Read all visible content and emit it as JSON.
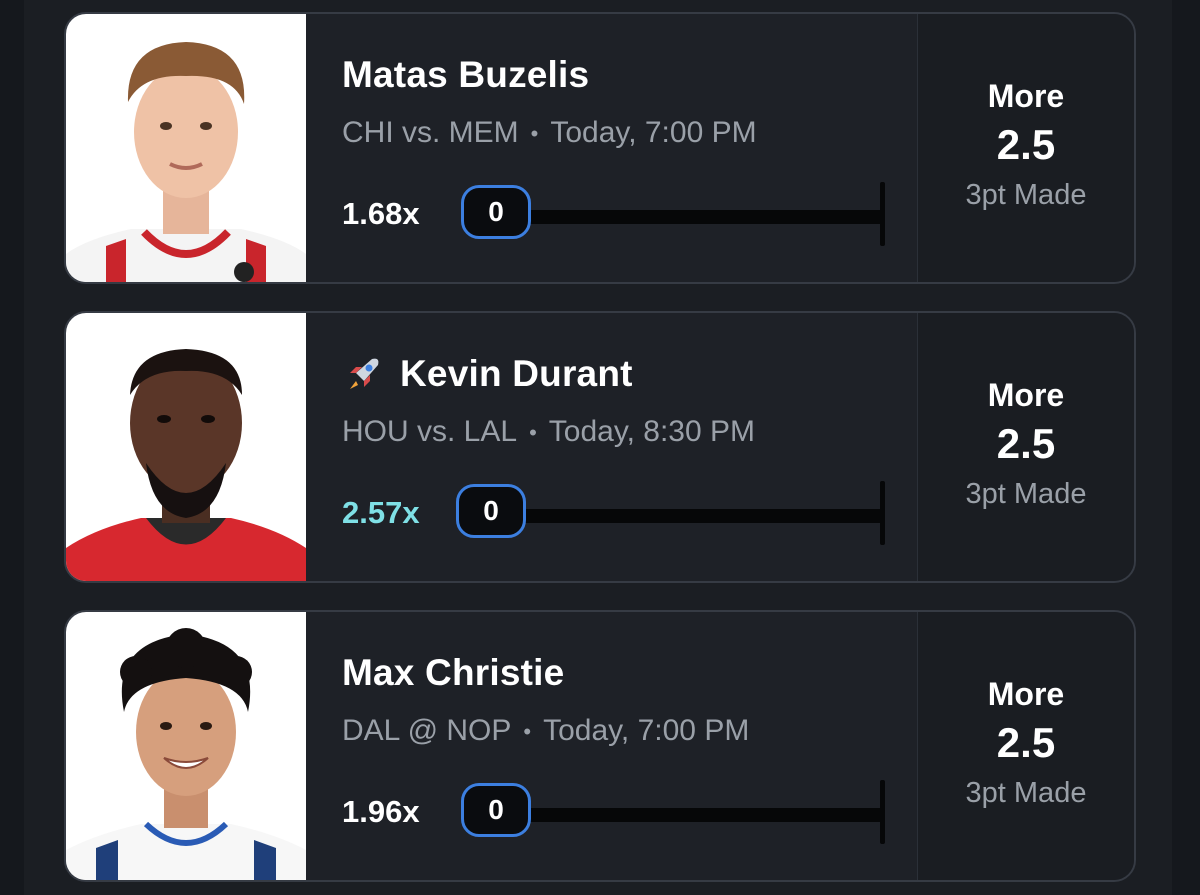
{
  "props": [
    {
      "player": "Matas Buzelis",
      "matchup": "CHI vs. MEM",
      "separator": "•",
      "time": "Today, 7:00 PM",
      "multiplier": "1.68x",
      "multiplier_color": "#ffffff",
      "stepper_value": "0",
      "direction": "More",
      "line": "2.5",
      "stat": "3pt Made",
      "badge_icon": ""
    },
    {
      "player": "Kevin Durant",
      "matchup": "HOU vs. LAL",
      "separator": "•",
      "time": "Today, 8:30 PM",
      "multiplier": "2.57x",
      "multiplier_color": "#7fe0e6",
      "stepper_value": "0",
      "direction": "More",
      "line": "2.5",
      "stat": "3pt Made",
      "badge_icon": "rocket-icon"
    },
    {
      "player": "Max Christie",
      "matchup": "DAL @ NOP",
      "separator": "•",
      "time": "Today, 7:00 PM",
      "multiplier": "1.96x",
      "multiplier_color": "#ffffff",
      "stepper_value": "0",
      "direction": "More",
      "line": "2.5",
      "stat": "3pt Made",
      "badge_icon": ""
    }
  ],
  "colors": {
    "background": "#15181d",
    "card": "#1e2127",
    "card_border": "#363b44",
    "stepper_border": "#3c7fe0",
    "muted_text": "#9aa0a8",
    "boost_multiplier": "#7fe0e6"
  }
}
